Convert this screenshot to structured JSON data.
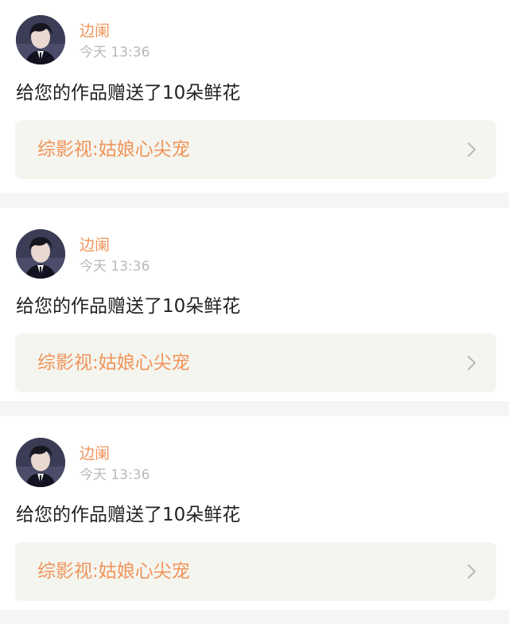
{
  "posts": [
    {
      "username": "边阑",
      "time": "今天 13:36",
      "message": "给您的作品赠送了10朵鲜花",
      "work_title": "综影视:姑娘心尖宠",
      "avatar_icon": "person-portrait-avatar",
      "chevron_icon": "chevron-right-icon"
    },
    {
      "username": "边阑",
      "time": "今天 13:36",
      "message": "给您的作品赠送了10朵鲜花",
      "work_title": "综影视:姑娘心尖宠",
      "avatar_icon": "person-portrait-avatar",
      "chevron_icon": "chevron-right-icon"
    },
    {
      "username": "边阑",
      "time": "今天 13:36",
      "message": "给您的作品赠送了10朵鲜花",
      "work_title": "综影视:姑娘心尖宠",
      "avatar_icon": "person-portrait-avatar",
      "chevron_icon": "chevron-right-icon"
    }
  ],
  "colors": {
    "accent": "#f0945a",
    "time": "#b9b9b9",
    "text": "#222222",
    "link_bg": "#f5f5ef",
    "page_bg": "#f7f5f4"
  }
}
